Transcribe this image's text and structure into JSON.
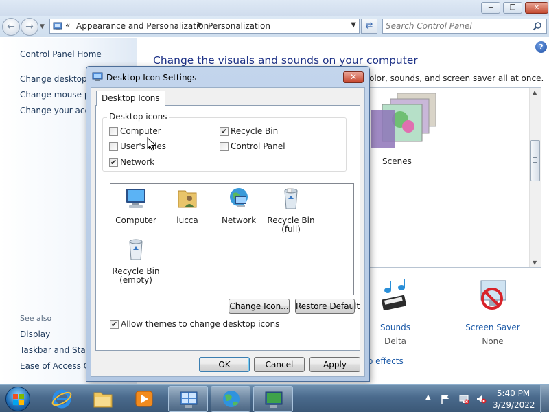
{
  "window": {
    "minimize_icon": "minimize-icon",
    "maximize_icon": "maximize-icon",
    "close_icon": "close-icon"
  },
  "navbar": {
    "address": {
      "overflow": "«",
      "crumbs": [
        "Appearance and Personalization",
        "Personalization"
      ]
    },
    "search_placeholder": "Search Control Panel"
  },
  "sidebar": {
    "home": "Control Panel Home",
    "links": [
      "Change desktop icons",
      "Change mouse pointers",
      "Change your account picture"
    ],
    "see_also_label": "See also",
    "see_also": [
      "Display",
      "Taskbar and Start Menu",
      "Ease of Access Center"
    ]
  },
  "main": {
    "heading": "Change the visuals and sounds on your computer",
    "subtext": "olor, sounds, and screen saver all at once.",
    "theme_name": "Scenes",
    "sounds": {
      "title": "Sounds",
      "value": "Delta"
    },
    "screen_saver": {
      "title": "Screen Saver",
      "value": "None"
    },
    "effects_link": "o effects"
  },
  "dialog": {
    "title": "Desktop Icon Settings",
    "tab": "Desktop Icons",
    "group_label": "Desktop icons",
    "checkboxes": [
      {
        "label": "Computer",
        "checked": false
      },
      {
        "label": "User's Files",
        "checked": false
      },
      {
        "label": "Network",
        "checked": true
      },
      {
        "label": "Recycle Bin",
        "checked": true
      },
      {
        "label": "Control Panel",
        "checked": false
      }
    ],
    "icons": [
      {
        "label": "Computer",
        "icon": "computer-icon"
      },
      {
        "label": "lucca",
        "icon": "user-folder-icon"
      },
      {
        "label": "Network",
        "icon": "network-icon"
      },
      {
        "label": "Recycle Bin\n(full)",
        "icon": "recycle-bin-full-icon"
      },
      {
        "label": "Recycle Bin\n(empty)",
        "icon": "recycle-bin-empty-icon"
      }
    ],
    "change_icon": "Change Icon...",
    "restore_default": "Restore Default",
    "allow_themes": {
      "label": "Allow themes to change desktop icons",
      "checked": true
    },
    "ok": "OK",
    "cancel": "Cancel",
    "apply": "Apply"
  },
  "taskbar": {
    "time": "5:40 PM",
    "date": "3/29/2022"
  }
}
